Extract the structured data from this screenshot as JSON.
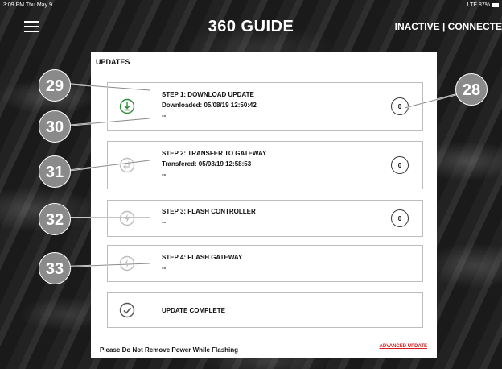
{
  "status_bar": {
    "time": "3:09 PM  Thu May 9",
    "signal": "LTE 87%"
  },
  "header": {
    "title": "360 GUIDE",
    "connection": "INACTIVE | CONNECTE"
  },
  "updates": {
    "title": "UPDATES",
    "steps": [
      {
        "title": "STEP 1: DOWNLOAD UPDATE",
        "detail": "Downloaded: 05/08/19 12:50:42",
        "extra": "--",
        "count": "0",
        "icon": "download-check-icon"
      },
      {
        "title": "STEP 2: TRANSFER TO GATEWAY",
        "detail": "Transfered: 05/08/19 12:58:53",
        "extra": "--",
        "count": "0",
        "icon": "transfer-icon"
      },
      {
        "title": "STEP 3: FLASH CONTROLLER",
        "detail": "",
        "extra": "--",
        "count": "0",
        "icon": "flash-icon"
      },
      {
        "title": "STEP 4: FLASH GATEWAY",
        "detail": "",
        "extra": "--",
        "icon": "flash-icon"
      },
      {
        "title": "UPDATE COMPLETE",
        "icon": "check-icon"
      }
    ],
    "footer_note": "Please Do Not Remove Power While Flashing",
    "advanced_link": "ADVANCED UPDATE"
  },
  "callouts": [
    "29",
    "30",
    "31",
    "32",
    "33",
    "28"
  ],
  "colors": {
    "accent_green": "#2e8b3a",
    "link_red": "#d62020",
    "callout_gray": "#8a8a8a"
  }
}
